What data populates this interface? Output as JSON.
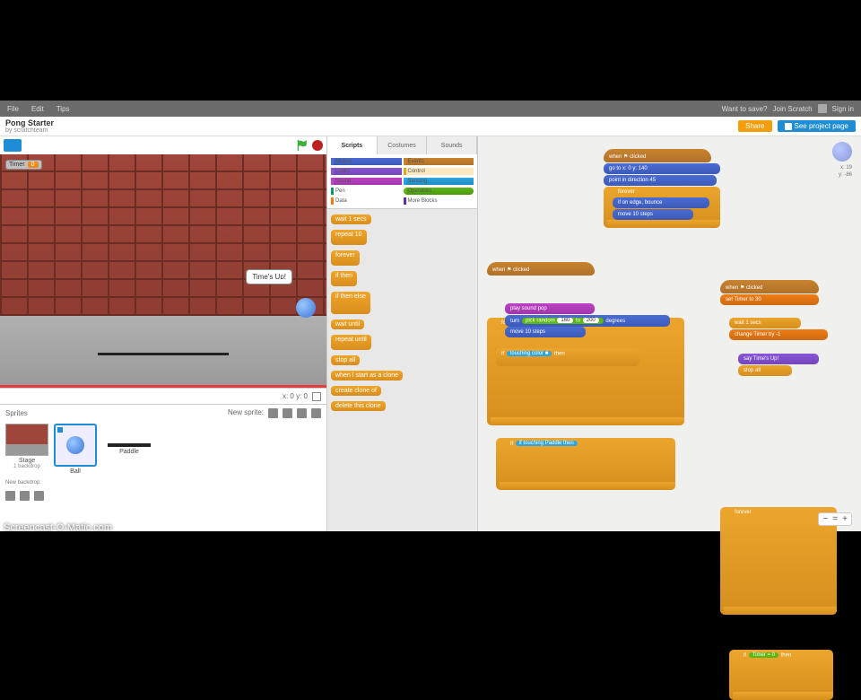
{
  "menubar": {
    "items": [
      "File",
      "Edit",
      "Tips"
    ],
    "right_msg": "Want to save?",
    "right_btn": "Join Scratch",
    "signin": "Sign in"
  },
  "header": {
    "title": "Pong Starter",
    "byline": "by scratchteam",
    "share_btn": "Share",
    "see_page_btn": "See project page"
  },
  "stage": {
    "timer_label": "Timer",
    "timer_value": "0",
    "speech": "Time's Up!",
    "coords": "x: 0  y: 0"
  },
  "sprites": {
    "header": "Sprites",
    "new_label": "New sprite:",
    "stage_label": "Stage",
    "stage_sub": "1 backdrop",
    "sprite1": "Ball",
    "sprite2": "Paddle",
    "new_backdrop": "New backdrop:"
  },
  "tabs": {
    "scripts": "Scripts",
    "costumes": "Costumes",
    "sounds": "Sounds"
  },
  "categories": {
    "motion": "Motion",
    "looks": "Looks",
    "sound": "Sound",
    "pen": "Pen",
    "data": "Data",
    "events": "Events",
    "control": "Control",
    "sensing": "Sensing",
    "operators": "Operators",
    "more": "More Blocks"
  },
  "palette": [
    "wait 1 secs",
    "repeat 10",
    "forever",
    "if then",
    "if then else",
    "wait until",
    "repeat until",
    "stop all",
    "when I start as a clone",
    "create clone of",
    "delete this clone"
  ],
  "scripts": {
    "s1_hat": "when ⚑ clicked",
    "s1_l1": "go to x: 0 y: 140",
    "s1_l2": "point in direction 45",
    "s1_l3": "forever",
    "s1_l4": "if on edge, bounce",
    "s1_l5": "move 10 steps",
    "s2_hat": "when ⚑ clicked",
    "s2_l1": "forever",
    "s2_l2": "if touching Paddle then",
    "s2_l3": "play sound pop",
    "s2_l4": "turn ↻ pick random 160 to 200 degrees",
    "s2_l5": "move 10 steps",
    "s2_l6": "if touching color ■ then",
    "s3_hat": "when ⚑ clicked",
    "s3_l1": "set Timer to 30",
    "s3_l2": "forever",
    "s3_l3": "wait 1 secs",
    "s3_l4": "change Timer by -1",
    "s3_l5": "if Timer = 0 then",
    "s3_l6": "say Time's Up!",
    "s3_l7": "stop all"
  },
  "zoom": {
    "minus": "−",
    "eq": "=",
    "plus": "+"
  },
  "coords": {
    "x": "x: 19",
    "y": "y: -86"
  },
  "watermark": "Screencast-O-Matic.com"
}
